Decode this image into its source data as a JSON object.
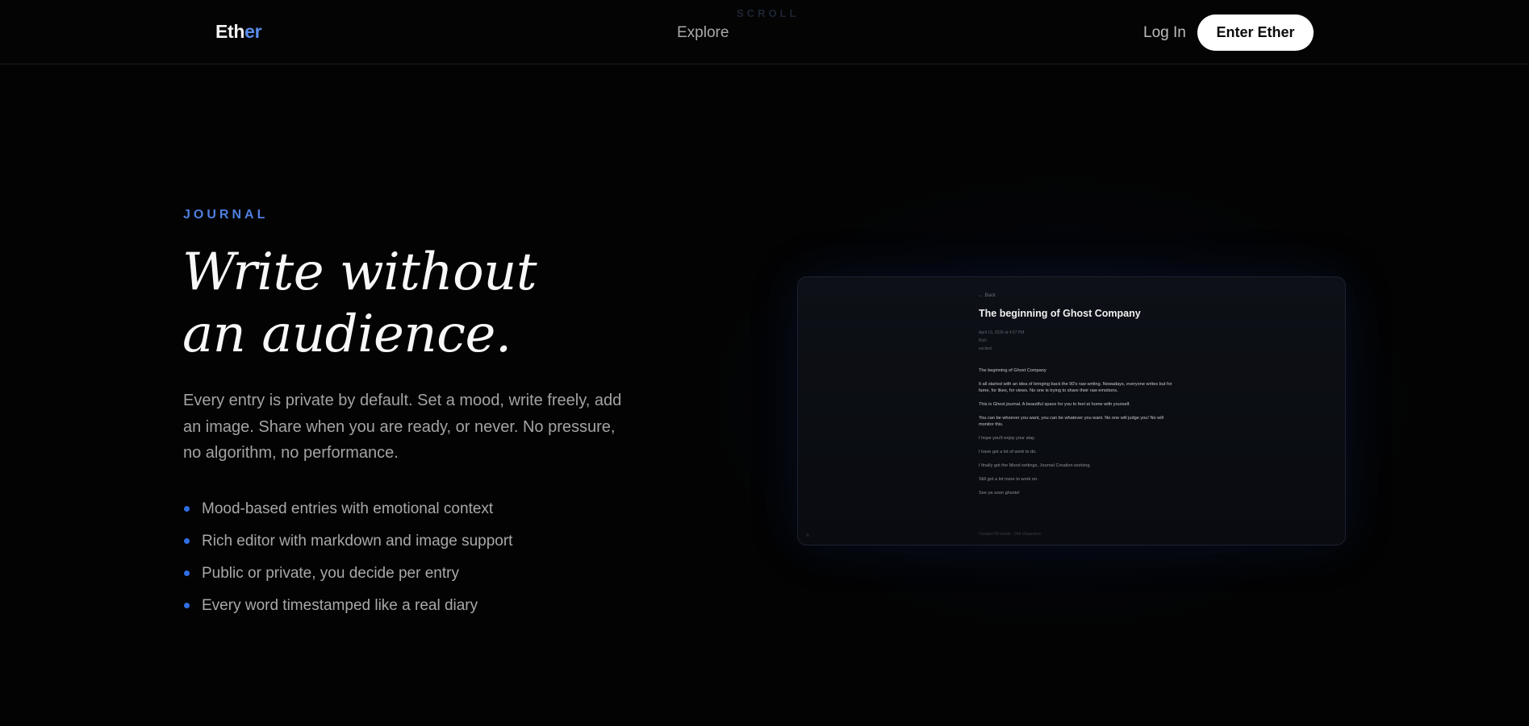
{
  "header": {
    "logo_main": "Eth",
    "logo_accent": "er",
    "scroll_hint": "SCROLL",
    "nav_explore": "Explore",
    "nav_login": "Log In",
    "cta_label": "Enter Ether"
  },
  "hero": {
    "eyebrow": "JOURNAL",
    "headline_line1": "Write without",
    "headline_line2": "an audience.",
    "description": "Every entry is private by default. Set a mood, write freely, add an image. Share when you are ready, or never. No pressure, no algorithm, no performance.",
    "features": [
      "Mood-based entries with emotional context",
      "Rich editor with markdown and image support",
      "Public or private, you decide per entry",
      "Every word timestamped like a real diary"
    ]
  },
  "preview": {
    "back_link": "← Back",
    "title": "The beginning of Ghost Company",
    "meta_date": "April 13, 2026 at 4:57 PM",
    "meta_mood": "Rich",
    "meta_status": "excited",
    "body": [
      "The beginning of Ghost Company",
      "It all started with an idea of bringing back the 90's raw writing. Nowadays, everyone writes but for fame, for likes, for views. No one is trying to share their raw emotions.",
      "This is Ghost journal. A beautiful space for you to feel at home with yourself.",
      "You can be whoever you want, you can be whatever you want. No one will judge you! No will monitor this.",
      "I hope you'll enjoy your stay.",
      "I have got a lot of work to do.",
      "I finally got the Mood settings, Journal Creation working.",
      "Still got a lot more to work on.",
      "See ya soon ghosts!"
    ],
    "footer": "Created 68 words · 364 characters",
    "corner": "N"
  },
  "colors": {
    "background": "#030303",
    "accent": "#4f7fe0",
    "bullet": "#2f6fe4",
    "cta_bg": "#ffffff"
  }
}
